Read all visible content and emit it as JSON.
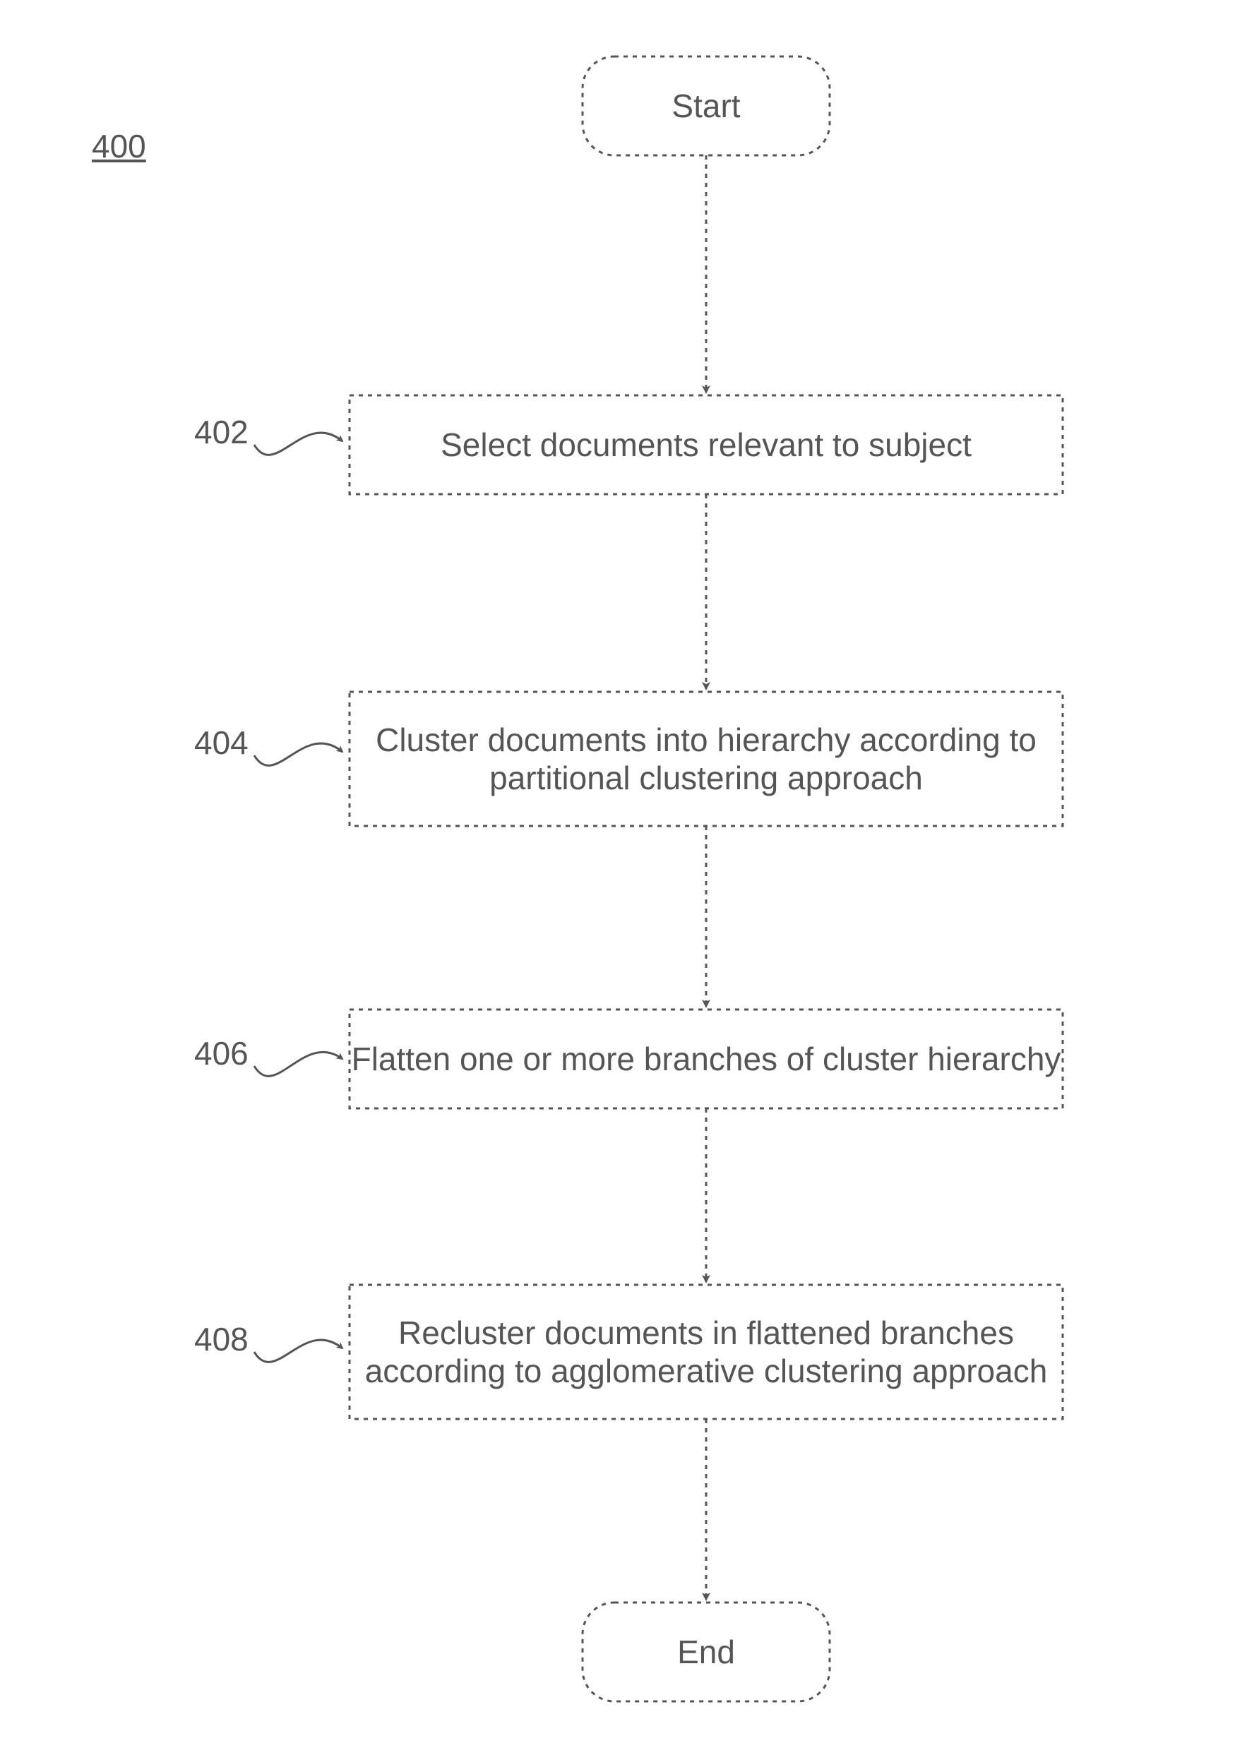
{
  "figure_label": "400",
  "nodes": {
    "start": "Start",
    "end": "End",
    "step1": "Select documents relevant to subject",
    "step2": "Cluster documents into hierarchy\naccording to partitional clustering approach",
    "step3": "Flatten one or more branches of cluster hierarchy",
    "step4": "Recluster documents in flattened branches\naccording to agglomerative clustering approach"
  },
  "step_refs": {
    "r1": "402",
    "r2": "404",
    "r3": "406",
    "r4": "408"
  }
}
